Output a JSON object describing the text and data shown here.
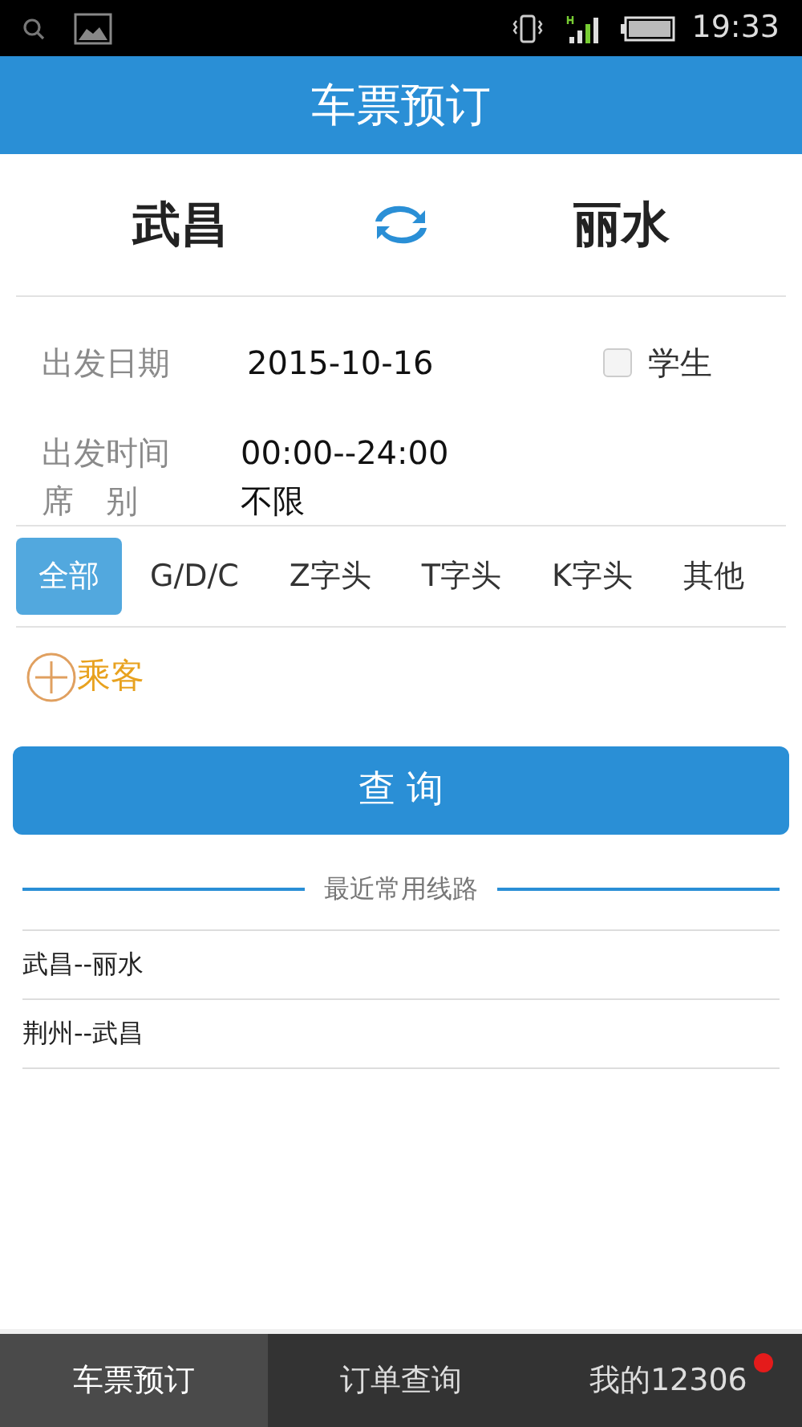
{
  "status_bar": {
    "time": "19:33"
  },
  "header": {
    "title": "车票预订"
  },
  "route": {
    "from": "武昌",
    "to": "丽水"
  },
  "form": {
    "date": {
      "label": "出发日期",
      "value": "2015-10-16"
    },
    "student": {
      "label": "学生",
      "checked": false
    },
    "time": {
      "label": "出发时间",
      "value": "00:00--24:00"
    },
    "seat": {
      "label": "席　别",
      "value": "不限"
    }
  },
  "train_types": [
    {
      "label": "全部",
      "selected": true
    },
    {
      "label": "G/D/C",
      "selected": false
    },
    {
      "label": "Z字头",
      "selected": false
    },
    {
      "label": "T字头",
      "selected": false
    },
    {
      "label": "K字头",
      "selected": false
    },
    {
      "label": "其他",
      "selected": false
    }
  ],
  "passenger": {
    "label": "乘客"
  },
  "query_button": "查 询",
  "recent": {
    "title": "最近常用线路",
    "routes": [
      "武昌--丽水",
      "荆州--武昌"
    ]
  },
  "bottom_nav": [
    {
      "label": "车票预订",
      "selected": true,
      "badge": false
    },
    {
      "label": "订单查询",
      "selected": false,
      "badge": false
    },
    {
      "label": "我的12306",
      "selected": false,
      "badge": true
    }
  ]
}
